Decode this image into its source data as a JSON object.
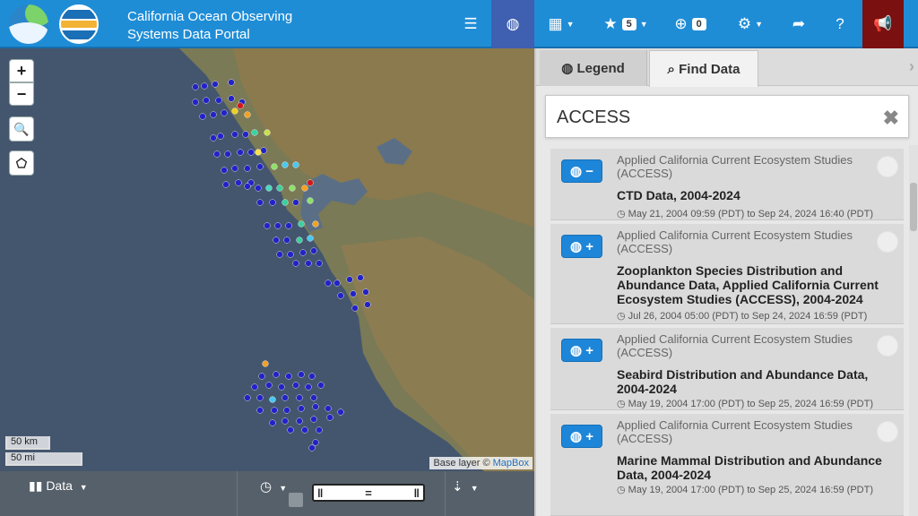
{
  "header": {
    "title_line1": "California Ocean Observing",
    "title_line2": "Systems Data Portal",
    "favorites_count": "5",
    "downloads_count": "0"
  },
  "map": {
    "zoom_in": "+",
    "zoom_out": "−",
    "scale_km": "50 km",
    "scale_mi": "50 mi",
    "attribution_prefix": "Base layer ©",
    "attribution_link": "MapBox"
  },
  "bottombar": {
    "data_label": "Data"
  },
  "panel": {
    "tab_legend": "Legend",
    "tab_find": "Find Data",
    "search_value": "ACCESS",
    "results": [
      {
        "org": "Applied California Current Ecosystem Studies (ACCESS)",
        "title": "CTD Data, 2004-2024",
        "dates": "May 21, 2004 09:59 (PDT) to Sep 24, 2024 16:40 (PDT)",
        "added": true
      },
      {
        "org": "Applied California Current Ecosystem Studies (ACCESS)",
        "title": "Zooplankton Species Distribution and Abundance Data, Applied California Current Ecosystem Studies (ACCESS), 2004-2024",
        "dates": "Jul 26, 2004 05:00 (PDT) to Sep 24, 2024 16:59 (PDT)",
        "added": false
      },
      {
        "org": "Applied California Current Ecosystem Studies (ACCESS)",
        "title": "Seabird Distribution and Abundance Data, 2004-2024",
        "dates": "May 19, 2004 17:00 (PDT) to Sep 25, 2024 16:59 (PDT)",
        "added": false
      },
      {
        "org": "Applied California Current Ecosystem Studies (ACCESS)",
        "title": "Marine Mammal Distribution and Abundance Data, 2004-2024",
        "dates": "May 19, 2004 17:00 (PDT) to Sep 25, 2024 16:59 (PDT)",
        "added": false
      }
    ]
  },
  "colors": {
    "header": "#1f8dd6",
    "active_tab": "#3f5fb0",
    "alert": "#7a1010",
    "button_blue": "#1e86d8"
  }
}
